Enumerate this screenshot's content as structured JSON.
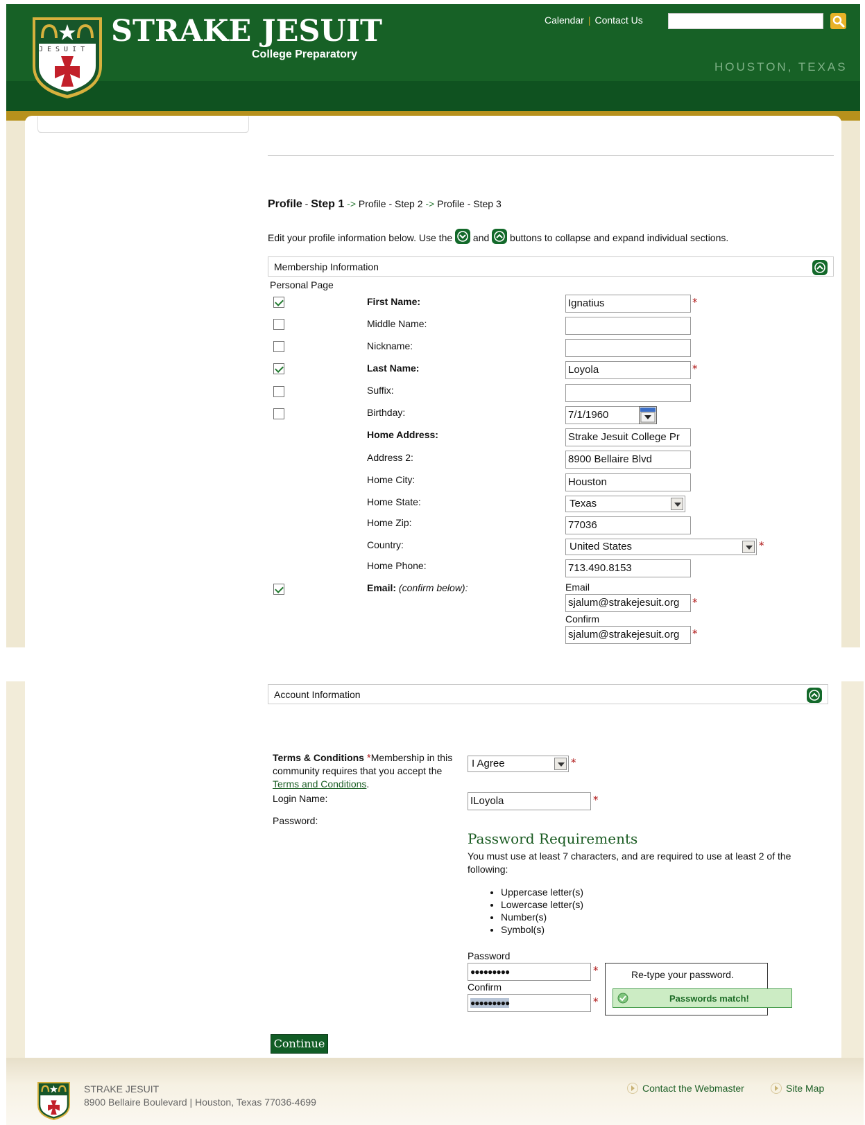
{
  "header": {
    "brand": "STRAKE JESUIT",
    "brand_sub": "College Preparatory",
    "crest_text": "JESUIT",
    "links": [
      "Calendar",
      "Contact Us"
    ],
    "location": "HOUSTON, TEXAS",
    "search_placeholder": ""
  },
  "steps": {
    "step1": "Profile",
    "step1_suffix": " - ",
    "step1_bold": "Step 1",
    "arrow": " -> ",
    "step2": "Profile - Step 2",
    "step3": "Profile - Step 3"
  },
  "intro": {
    "before": "Edit your profile information below. Use the ",
    "middle": " and ",
    "after": " buttons to collapse and expand individual sections."
  },
  "membership": {
    "title": "Membership Information",
    "personal_page_label": "Personal Page",
    "fields": {
      "first_name": {
        "label": "First Name:",
        "value": "Ignatius"
      },
      "middle_name": {
        "label": "Middle Name:",
        "value": ""
      },
      "nickname": {
        "label": "Nickname:",
        "value": ""
      },
      "last_name": {
        "label": "Last Name:",
        "value": "Loyola"
      },
      "suffix": {
        "label": "Suffix:",
        "value": ""
      },
      "birthday": {
        "label": "Birthday:",
        "value": "7/1/1960"
      },
      "home_address": {
        "label": "Home Address:",
        "value": "Strake Jesuit College Pr"
      },
      "address2": {
        "label": "Address 2:",
        "value": "8900 Bellaire Blvd"
      },
      "home_city": {
        "label": "Home City:",
        "value": "Houston"
      },
      "home_state": {
        "label": "Home State:",
        "value": "Texas"
      },
      "home_zip": {
        "label": "Home Zip:",
        "value": "77036"
      },
      "country": {
        "label": "Country:",
        "value": "United States"
      },
      "home_phone": {
        "label": "Home Phone:",
        "value": "713.490.8153"
      },
      "email": {
        "label": "Email:",
        "label_note": "(confirm below):",
        "sub_email": "Email",
        "value": "sjalum@strakejesuit.org",
        "sub_confirm": "Confirm",
        "confirm_value": "sjalum@strakejesuit.org"
      }
    }
  },
  "account": {
    "title": "Account Information",
    "terms_bold": "Terms & Conditions",
    "terms_star": "*",
    "terms_text1": "Membership in this",
    "terms_text2": "community requires that you accept the",
    "terms_link": "Terms and Conditions",
    "terms_dot": ".",
    "terms_value": "I Agree",
    "login_label": "Login Name:",
    "login_value": "ILoyola",
    "password_label": "Password:",
    "pw_req_title": "Password Requirements",
    "pw_req_text": "You must use at least 7 characters, and are required to use at least 2 of the following:",
    "pw_req_items": [
      "Uppercase letter(s)",
      "Lowercase letter(s)",
      "Number(s)",
      "Symbol(s)"
    ],
    "pw_sub_password": "Password",
    "pw_value": "●●●●●●●●●",
    "pw_sub_confirm": "Confirm",
    "pw_confirm_value": "●●●●●●●●●",
    "retype_msg": "Re-type your password.",
    "match_msg": "Passwords match!"
  },
  "continue_label": "Continue",
  "footer": {
    "name": "STRAKE JESUIT",
    "address": "8900 Bellaire Boulevard | Houston, Texas 77036-4699",
    "links": [
      "Contact the Webmaster",
      "Site Map"
    ]
  },
  "colors": {
    "brand_green": "#176126",
    "gold": "#b7911c",
    "required": "#b01818"
  }
}
